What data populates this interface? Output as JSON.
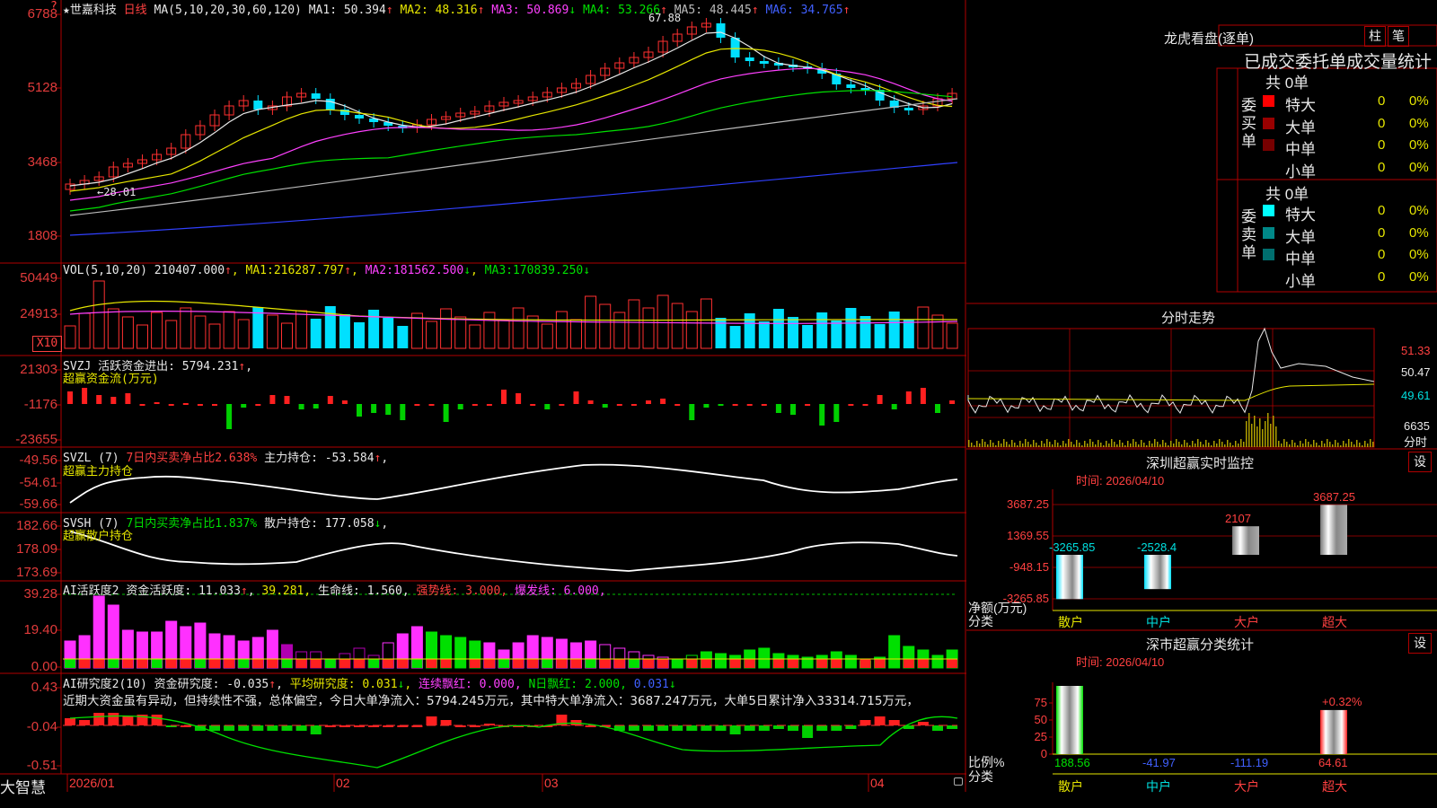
{
  "stock": {
    "star": "★",
    "name": "世嘉科技",
    "period": "日线"
  },
  "kline": {
    "ma_header": "MA(5,10,20,30,60,120)",
    "ma": [
      {
        "label": "MA1:",
        "value": "50.394",
        "arrow": "↑",
        "color": "#e8e8e8"
      },
      {
        "label": "MA2:",
        "value": "48.316",
        "arrow": "↑",
        "color": "#e6e600"
      },
      {
        "label": "MA3:",
        "value": "50.869",
        "arrow": "↓",
        "color": "#ff40ff"
      },
      {
        "label": "MA4:",
        "value": "53.266",
        "arrow": "↑",
        "color": "#00e000"
      },
      {
        "label": "MA5:",
        "value": "48.445",
        "arrow": "↑",
        "color": "#bbbbbb"
      },
      {
        "label": "MA6:",
        "value": "34.765",
        "arrow": "↑",
        "color": "#4060ff"
      }
    ],
    "y_labels": [
      "6788",
      "5128",
      "3468",
      "1808"
    ],
    "corner": "?",
    "high_marker": "67.88",
    "low_marker": "←28.01"
  },
  "vol": {
    "header": "VOL(5,10,20)",
    "value": "210407.000",
    "ma1": {
      "label": "MA1:",
      "value": "216287.797",
      "arrow": "↑"
    },
    "ma2": {
      "label": "MA2:",
      "value": "181562.500",
      "arrow": "↓"
    },
    "ma3": {
      "label": "MA3:",
      "value": "170839.250",
      "arrow": "↓"
    },
    "y_labels": [
      "50449",
      "24913"
    ],
    "unit": "X10"
  },
  "svzj": {
    "name": "SVZJ",
    "label": "活跃资金进出:",
    "value": "5794.231",
    "arrow": "↑",
    "subtitle": "超赢资金流(万元)",
    "y_labels": [
      "21303",
      "-1176",
      "-23655"
    ]
  },
  "svzl": {
    "name": "SVZL (7)",
    "desc": "7日内买卖净占比2.638%",
    "label": "主力持仓:",
    "value": "-53.584",
    "arrow": "↑",
    "subtitle": "超赢主力持仓",
    "y_labels": [
      "-49.56",
      "-54.61",
      "-59.66"
    ]
  },
  "svsh": {
    "name": "SVSH (7)",
    "desc": "7日内买卖净占比1.837%",
    "label": "散户持仓:",
    "value": "177.058",
    "arrow": "↓",
    "subtitle": "超赢散户持仓",
    "y_labels": [
      "182.66",
      "178.09",
      "173.69"
    ]
  },
  "ai_active": {
    "name": "AI活跃度2",
    "label": "资金活跃度:",
    "value": "11.033",
    "arrow": "↑",
    "value2": "39.281",
    "life_label": "生命线:",
    "life_value": "1.560",
    "strong_label": "强势线:",
    "strong_value": "3.000",
    "burst_label": "爆发线:",
    "burst_value": "6.000",
    "y_labels": [
      "39.28",
      "19.40",
      "0.00"
    ]
  },
  "ai_research": {
    "name": "AI研究度2(10)",
    "label": "资金研究度:",
    "value": "-0.035",
    "arrow": "↑",
    "avg_label": "平均研究度:",
    "avg_value": "0.031",
    "avg_arrow": "↓",
    "cont_label": "连续飘红:",
    "cont_value": "0.000",
    "nday_label": "N日飘红:",
    "nday_value": "2.000",
    "nday_extra": "0.031",
    "comment": "近期大资金虽有异动，但持续性不强，总体偏空，今日大单净流入：5794.245万元，其中特大单净流入：3687.247万元，大单5日累计净入33314.715万元，",
    "y_labels": [
      "0.43",
      "-0.04",
      "-0.51"
    ]
  },
  "date_axis": {
    "app": "大智慧",
    "labels": [
      "2026/01",
      "02",
      "03",
      "04"
    ]
  },
  "right": {
    "lhb_title": "龙虎看盘(逐单)",
    "tab_bar": "柱",
    "tab_pen": "笔",
    "order_title": "已成交委托单成交量统计",
    "buy": {
      "side_label": "委买单",
      "total": "共 0单",
      "rows": [
        {
          "label": "特大",
          "count": "0",
          "pct": "0%",
          "color": "#ff0000"
        },
        {
          "label": "大单",
          "count": "0",
          "pct": "0%",
          "color": "#990000"
        },
        {
          "label": "中单",
          "count": "0",
          "pct": "0%",
          "color": "#770000"
        },
        {
          "label": "小单",
          "count": "0",
          "pct": "0%",
          "color": "#000000"
        }
      ]
    },
    "sell": {
      "side_label": "委卖单",
      "total": "共 0单",
      "rows": [
        {
          "label": "特大",
          "count": "0",
          "pct": "0%",
          "color": "#00ffff"
        },
        {
          "label": "大单",
          "count": "0",
          "pct": "0%",
          "color": "#008888"
        },
        {
          "label": "中单",
          "count": "0",
          "pct": "0%",
          "color": "#006f6f"
        },
        {
          "label": "小单",
          "count": "0",
          "pct": "0%",
          "color": "#000000"
        }
      ]
    },
    "intraday": {
      "title": "分时走势",
      "y_labels": [
        "51.33",
        "50.47",
        "49.61"
      ],
      "vol_label": "6635",
      "vol_unit": "分时"
    },
    "monitor": {
      "title": "深圳超赢实时监控",
      "set": "设",
      "time": "时间: 2026/04/10",
      "y_labels": [
        "3687.25",
        "1369.55",
        "-948.15",
        "-3265.85"
      ],
      "y_unit": "净额(万元)",
      "x_unit": "分类",
      "categories": [
        "散户",
        "中户",
        "大户",
        "超大"
      ]
    },
    "classify": {
      "title": "深市超赢分类统计",
      "set": "设",
      "time": "时间: 2026/04/10",
      "y_labels": [
        "75",
        "50",
        "25",
        "0"
      ],
      "y_unit": "比例%",
      "x_unit": "分类",
      "categories": [
        "散户",
        "中户",
        "大户",
        "超大"
      ]
    }
  },
  "chart_data": [
    {
      "type": "bar",
      "title": "深圳超赢实时监控",
      "ylabel": "净额(万元)",
      "xlabel": "分类",
      "categories": [
        "散户",
        "中户",
        "大户",
        "超大"
      ],
      "values": [
        -3265.85,
        -2528.4,
        2107,
        3687.25
      ],
      "ylim": [
        -3265.85,
        3687.25
      ]
    },
    {
      "type": "bar",
      "title": "深市超赢分类统计",
      "ylabel": "比例%",
      "xlabel": "分类",
      "categories": [
        "散户",
        "中户",
        "大户",
        "超大"
      ],
      "values": [
        188.56,
        -41.97,
        -111.19,
        64.61
      ],
      "annotation": "+0.32%",
      "ylim": [
        0,
        75
      ]
    }
  ]
}
